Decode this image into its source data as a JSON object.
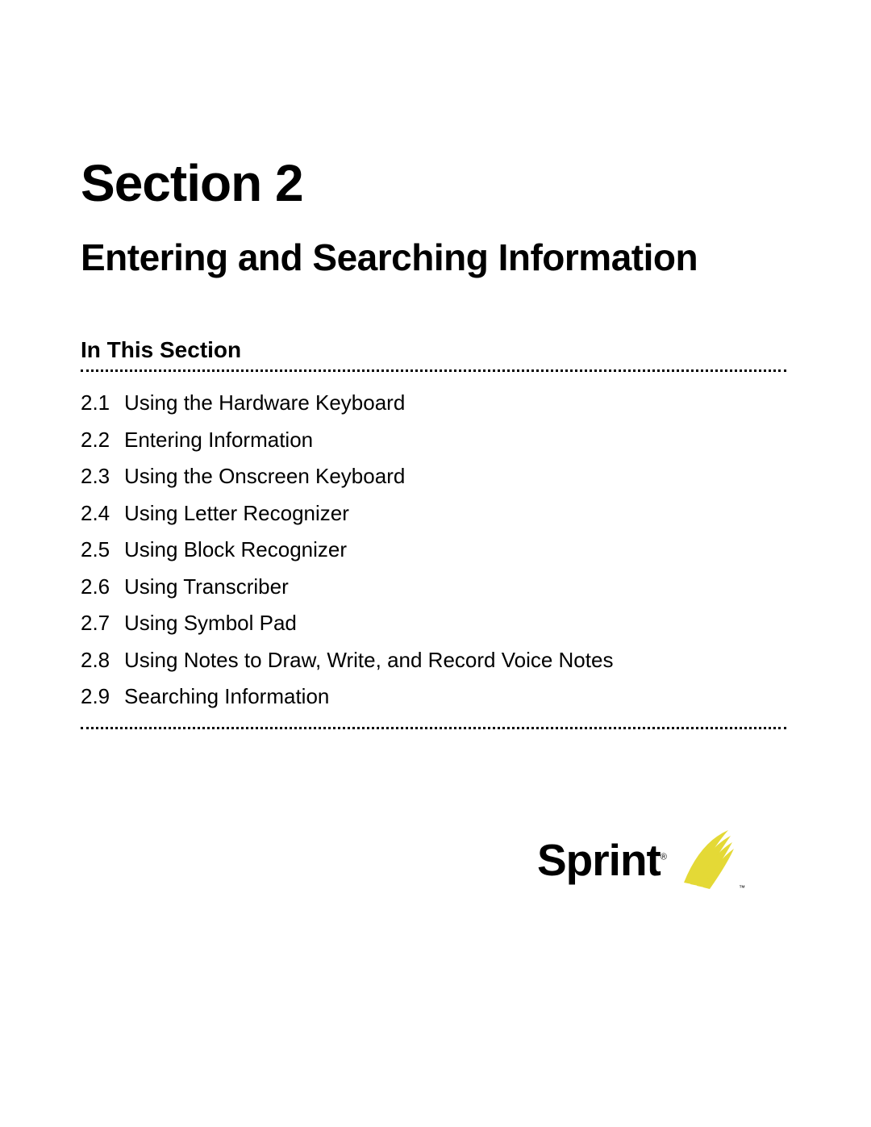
{
  "heading": "Section 2",
  "title": "Entering and Searching Information",
  "inThisSection": "In This Section",
  "toc": [
    {
      "num": "2.1",
      "text": "Using the Hardware Keyboard"
    },
    {
      "num": "2.2",
      "text": "Entering Information"
    },
    {
      "num": "2.3",
      "text": "Using the Onscreen Keyboard"
    },
    {
      "num": "2.4",
      "text": "Using Letter Recognizer"
    },
    {
      "num": "2.5",
      "text": "Using Block Recognizer"
    },
    {
      "num": "2.6",
      "text": "Using Transcriber"
    },
    {
      "num": "2.7",
      "text": "Using Symbol Pad"
    },
    {
      "num": "2.8",
      "text": "Using Notes to Draw, Write, and Record Voice Notes"
    },
    {
      "num": "2.9",
      "text": "Searching Information"
    }
  ],
  "logo": {
    "brand": "Sprint",
    "registered": "®",
    "trademark": "™",
    "color": "#e4d936"
  }
}
